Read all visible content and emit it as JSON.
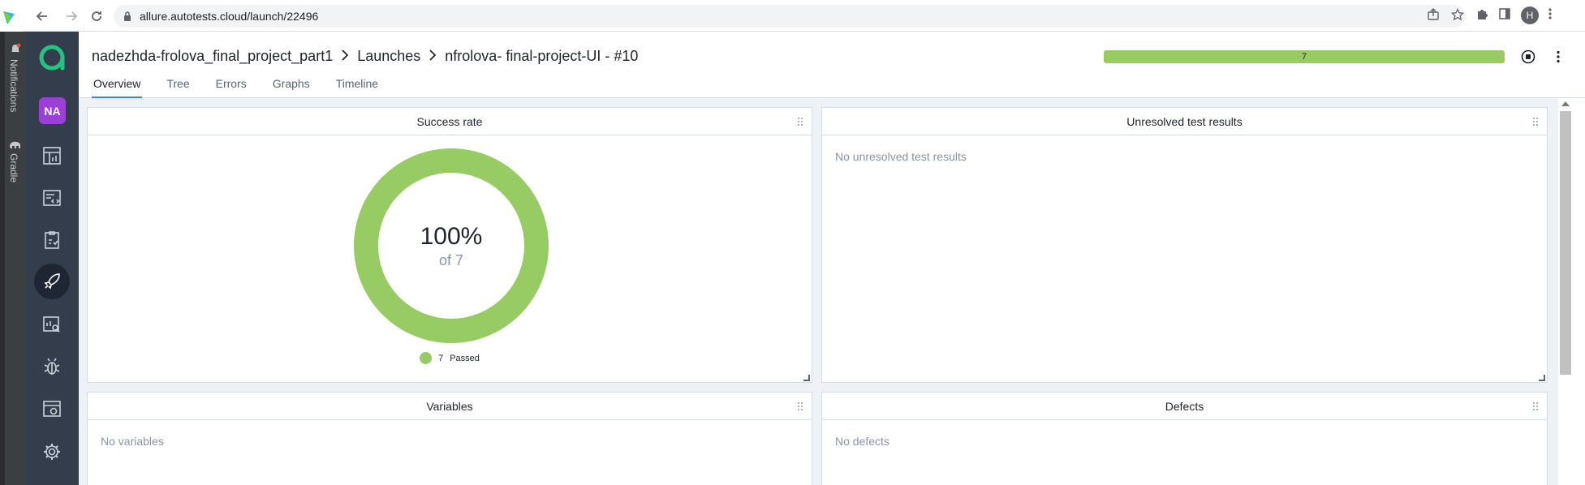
{
  "browser": {
    "url": "allure.autotests.cloud/launch/22496",
    "profile_initial": "H"
  },
  "ide": {
    "notifications_label": "Notifications",
    "gradle_label": "Gradle"
  },
  "sidebar": {
    "avatar_initials": "NA",
    "items": [
      {
        "name": "dashboards-icon"
      },
      {
        "name": "test-cases-icon"
      },
      {
        "name": "test-plans-icon"
      },
      {
        "name": "launches-icon",
        "active": true
      },
      {
        "name": "analytics-icon"
      },
      {
        "name": "defects-icon"
      },
      {
        "name": "jobs-icon"
      },
      {
        "name": "settings-icon"
      }
    ]
  },
  "header": {
    "breadcrumb": {
      "project": "nadezhda-frolova_final_project_part1",
      "section": "Launches",
      "launch": "nfrolova- final-project-UI - #10"
    },
    "progress_count": "7",
    "tabs": [
      "Overview",
      "Tree",
      "Errors",
      "Graphs",
      "Timeline"
    ],
    "active_tab": "Overview"
  },
  "widgets": {
    "success_rate": {
      "title": "Success rate",
      "rate": "100%",
      "of": "of 7",
      "legend_count": "7",
      "legend_label": "Passed",
      "color_passed": "#97cc64"
    },
    "unresolved": {
      "title": "Unresolved test results",
      "empty": "No unresolved test results"
    },
    "variables": {
      "title": "Variables",
      "empty": "No variables"
    },
    "defects": {
      "title": "Defects",
      "empty": "No defects"
    }
  }
}
